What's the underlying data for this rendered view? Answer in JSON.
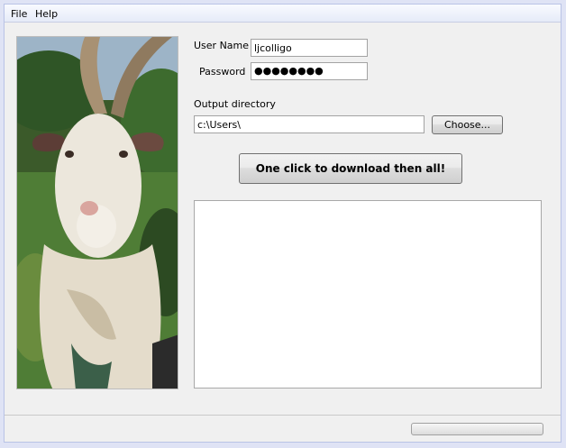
{
  "menu": {
    "file_label": "File",
    "help_label": "Help"
  },
  "login": {
    "username_label": "User Name",
    "username_value": "ljcolligo",
    "password_label": "Password",
    "password_value": "●●●●●●●●"
  },
  "output": {
    "label": "Output directory",
    "path_value": "c:\\Users\\",
    "choose_label": "Choose..."
  },
  "download_button_label": "One click to download then all!",
  "log_text": "",
  "progress": {
    "fraction": 0
  },
  "colors": {
    "window_bg": "#f0f0f0",
    "border": "#b9c3e6",
    "progress_fill": "#5fc15f"
  },
  "image": {
    "subject": "goat-photo"
  }
}
